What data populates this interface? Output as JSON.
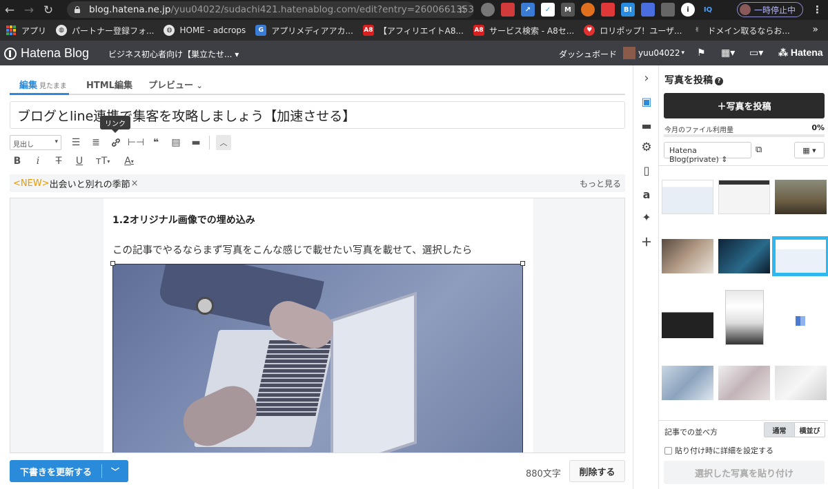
{
  "browser": {
    "url_host": "blog.hatena.ne.jp",
    "url_path": "/yuu04022/sudachi421.hatenablog.com/edit?entry=260066135328...",
    "pause_label": "一時停止中"
  },
  "bookmarks": [
    {
      "label": "アプリ",
      "icon": "apps-grid-icon"
    },
    {
      "label": "パートナー登録フォ...",
      "icon": "globe-icon"
    },
    {
      "label": "HOME - adcrops",
      "icon": "globe-icon"
    },
    {
      "label": "アプリメディアアカ...",
      "icon": "g-logo-icon"
    },
    {
      "label": "【アフィリエイトA8...",
      "icon": "a8-logo-icon"
    },
    {
      "label": "サービス検索 - A8セ...",
      "icon": "a8-logo-icon"
    },
    {
      "label": "ロリポップ！ユーザ...",
      "icon": "lolipop-icon"
    },
    {
      "label": "ドメイン取るならお...",
      "icon": "domain-icon"
    }
  ],
  "bookmarks_more": "»",
  "hatena_header": {
    "logo": "Hatena Blog",
    "blog_select": "ビジネス初心者向け【巣立たせ...",
    "dashboard": "ダッシュボード",
    "username": "yuu04022",
    "brand": "Hatena"
  },
  "editor": {
    "tabs": [
      {
        "label": "編集",
        "sub": "見たまま"
      },
      {
        "label": "HTML編集",
        "sub": ""
      },
      {
        "label": "プレビュー",
        "sub": ""
      }
    ],
    "title": "ブログとline連携で集客を攻略しましょう【加速させる】",
    "tooltip": "リンク",
    "heading_select": "見出し",
    "notice_new": "<NEW>",
    "notice_text": "出会いと別れの季節",
    "notice_close": "×",
    "more_link": "もっと見る",
    "section_heading": "1.2オリジナル画像での埋め込み",
    "paragraph": "この記事でやるならまず写真をこんな感じで載せたい写真を載せて、選択したら",
    "format_buttons": {
      "bold": "B",
      "italic": "i",
      "strike": "T",
      "underline": "U",
      "size": "тT",
      "color": "A"
    }
  },
  "footer": {
    "draft_button": "下書きを更新する",
    "char_count": "880文字",
    "delete_button": "削除する"
  },
  "photo_panel": {
    "title": "写真を投稿",
    "upload_button": "写真を投稿",
    "usage_label": "今月のファイル利用量",
    "usage_value": "0%",
    "usage_fraction": 0,
    "blog_select": "Hatena Blog(private)",
    "order_label": "記事での並べ方",
    "order_options": [
      "通常",
      "横並び"
    ],
    "detail_checkbox": "貼り付け時に詳細を設定する",
    "paste_button": "選択した写真を貼り付け"
  },
  "colors": {
    "accent": "#2b8bdb",
    "header": "#3d3f44",
    "selected_thumb": "#2eb8ef",
    "notice_new": "#e89a00"
  }
}
